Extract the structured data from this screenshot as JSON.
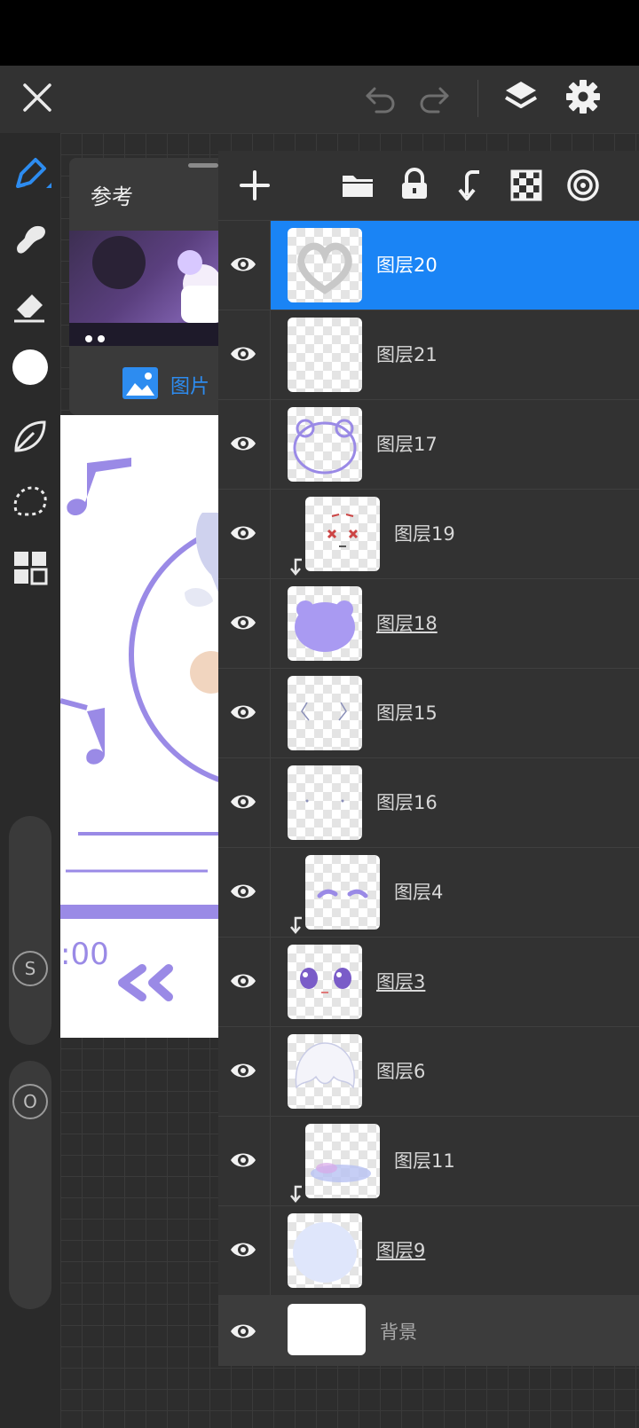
{
  "topbar": {
    "close_icon": "close-icon",
    "undo_icon": "undo-icon",
    "redo_icon": "redo-icon",
    "layers_icon": "layers-icon",
    "settings_icon": "gear-icon"
  },
  "tools": [
    "brush-pen-icon",
    "smudge-icon",
    "eraser-icon",
    "color-swatch",
    "leaf-icon",
    "lasso-select-icon",
    "grid-icon"
  ],
  "sliders": {
    "size_label": "S",
    "opacity_label": "O"
  },
  "reference": {
    "title": "参考",
    "tab_label": "图片"
  },
  "canvas": {
    "time_text": ":00"
  },
  "layers_toolbar": [
    "add-icon",
    "folder-icon",
    "lock-icon",
    "merge-down-icon",
    "transparency-icon",
    "target-icon"
  ],
  "layers": [
    {
      "name": "图层20",
      "selected": true,
      "clipped": false,
      "underline": false,
      "thumb": "heart"
    },
    {
      "name": "图层21",
      "selected": false,
      "clipped": false,
      "underline": false,
      "thumb": "empty"
    },
    {
      "name": "图层17",
      "selected": false,
      "clipped": false,
      "underline": false,
      "thumb": "bear-outline"
    },
    {
      "name": "图层19",
      "selected": false,
      "clipped": true,
      "underline": false,
      "thumb": "face"
    },
    {
      "name": "图层18",
      "selected": false,
      "clipped": false,
      "underline": true,
      "thumb": "bear-fill"
    },
    {
      "name": "图层15",
      "selected": false,
      "clipped": false,
      "underline": false,
      "thumb": "sketch"
    },
    {
      "name": "图层16",
      "selected": false,
      "clipped": false,
      "underline": false,
      "thumb": "dots"
    },
    {
      "name": "图层4",
      "selected": false,
      "clipped": true,
      "underline": false,
      "thumb": "brows"
    },
    {
      "name": "图层3",
      "selected": false,
      "clipped": false,
      "underline": true,
      "thumb": "eyes"
    },
    {
      "name": "图层6",
      "selected": false,
      "clipped": false,
      "underline": false,
      "thumb": "hair"
    },
    {
      "name": "图层11",
      "selected": false,
      "clipped": true,
      "underline": false,
      "thumb": "shade"
    },
    {
      "name": "图层9",
      "selected": false,
      "clipped": false,
      "underline": true,
      "thumb": "base"
    }
  ],
  "background_layer": {
    "name": "背景"
  },
  "colors": {
    "accent": "#1a84f5",
    "purple": "#9a8ae6"
  }
}
